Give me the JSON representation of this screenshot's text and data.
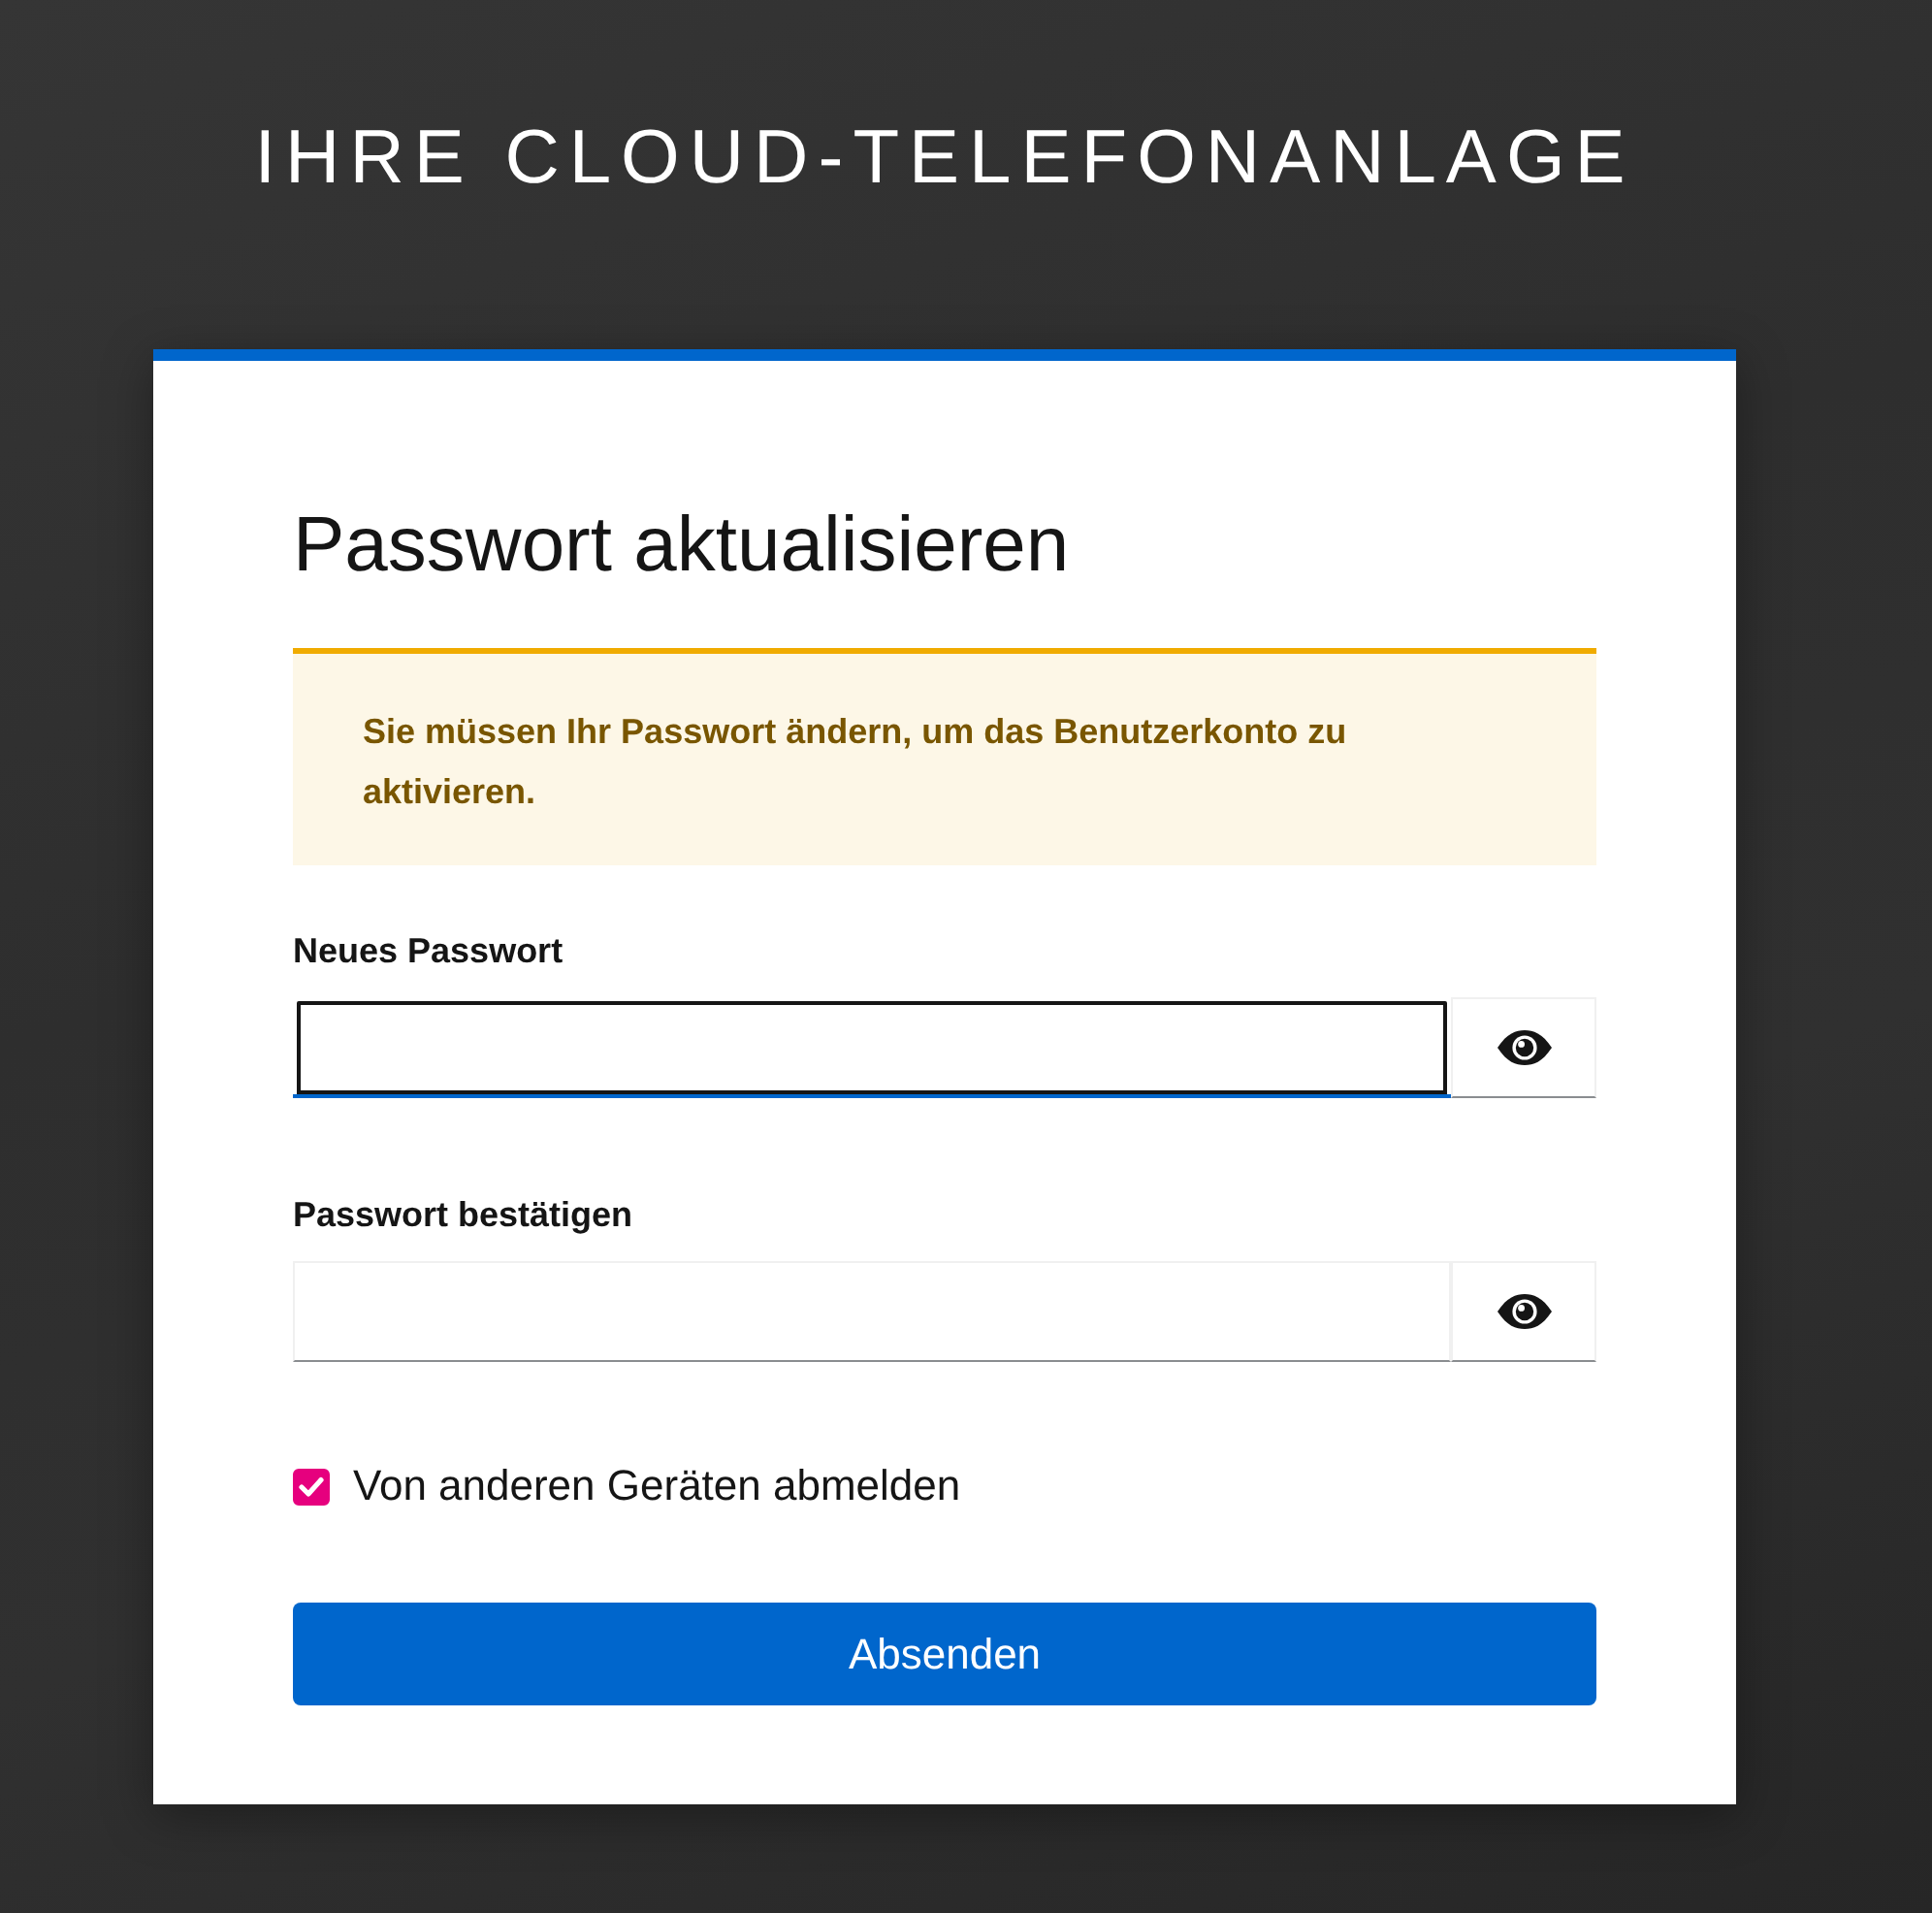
{
  "header": {
    "title": "IHRE CLOUD-TELEFONANLAGE"
  },
  "card": {
    "title": "Passwort aktualisieren",
    "alert": {
      "kind": "warning",
      "text": "Sie müssen Ihr Passwort ändern, um das Benutzerkonto zu aktivieren."
    },
    "fields": [
      {
        "label": "Neues Passwort",
        "focused": true
      },
      {
        "label": "Passwort bestätigen",
        "focused": false
      }
    ],
    "checkbox": {
      "label": "Von anderen Geräten abmelden",
      "checked": true
    },
    "submit_button": {
      "label": "Absenden"
    }
  }
}
